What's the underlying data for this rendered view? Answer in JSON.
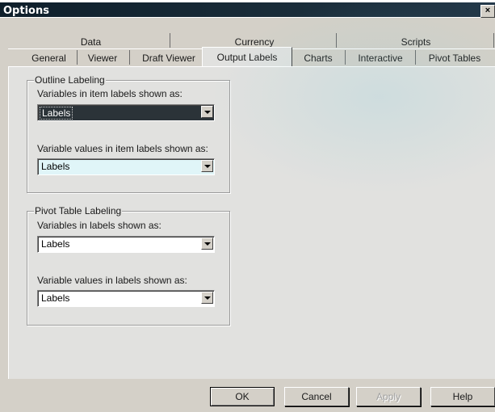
{
  "window": {
    "title": "Options",
    "close_symbol": "×"
  },
  "tabs": {
    "row1": [
      {
        "label": "Data"
      },
      {
        "label": "Currency"
      },
      {
        "label": "Scripts"
      }
    ],
    "row2": [
      {
        "label": "General"
      },
      {
        "label": "Viewer"
      },
      {
        "label": "Draft Viewer"
      },
      {
        "label": "Output Labels",
        "active": true
      },
      {
        "label": "Charts"
      },
      {
        "label": "Interactive"
      },
      {
        "label": "Pivot Tables"
      }
    ]
  },
  "outline_labeling": {
    "title": "Outline Labeling",
    "variables_label": "Variables in item labels shown as:",
    "variables_value": "Labels",
    "values_label": "Variable values in item labels shown as:",
    "values_value": "Labels"
  },
  "pivot_labeling": {
    "title": "Pivot Table Labeling",
    "variables_label": "Variables in labels shown as:",
    "variables_value": "Labels",
    "values_label": "Variable values in labels shown as:",
    "values_value": "Labels"
  },
  "buttons": {
    "ok": "OK",
    "cancel": "Cancel",
    "apply": "Apply",
    "help": "Help"
  }
}
